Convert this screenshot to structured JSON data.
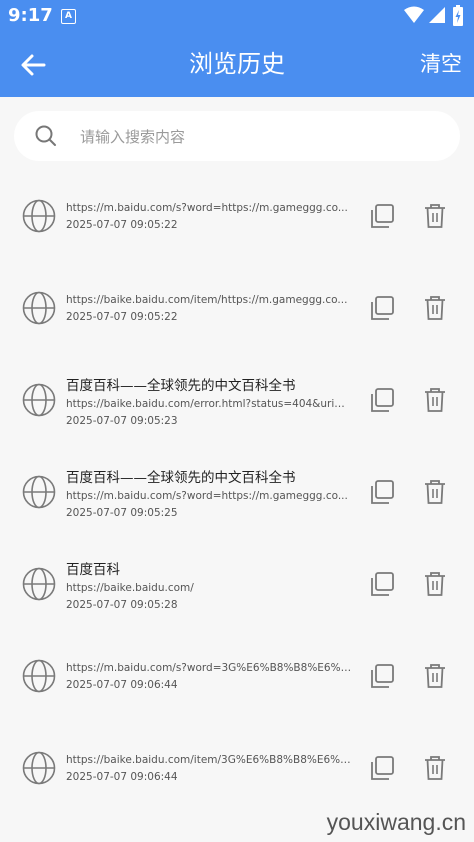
{
  "status": {
    "time": "9:17",
    "notification_badge": "A"
  },
  "appbar": {
    "title": "浏览历史",
    "clear_label": "清空"
  },
  "search": {
    "placeholder": "请输入搜索内容",
    "value": ""
  },
  "history": [
    {
      "title": "",
      "url": "https://m.baidu.com/s?word=https://m.gameggg.co...",
      "time": "2025-07-07 09:05:22"
    },
    {
      "title": "",
      "url": "https://baike.baidu.com/item/https://m.gameggg.co...",
      "time": "2025-07-07 09:05:22"
    },
    {
      "title": "百度百科——全球领先的中文百科全书",
      "url": "https://baike.baidu.com/error.html?status=404&uri=/i...",
      "time": "2025-07-07 09:05:23"
    },
    {
      "title": "百度百科——全球领先的中文百科全书",
      "url": "https://m.baidu.com/s?word=https://m.gameggg.co...",
      "time": "2025-07-07 09:05:25"
    },
    {
      "title": "百度百科",
      "url": "https://baike.baidu.com/",
      "time": "2025-07-07 09:05:28"
    },
    {
      "title": "",
      "url": "https://m.baidu.com/s?word=3G%E6%B8%B8%E6%88...",
      "time": "2025-07-07 09:06:44"
    },
    {
      "title": "",
      "url": "https://baike.baidu.com/item/3G%E6%B8%B8%E6%88...",
      "time": "2025-07-07 09:06:44"
    }
  ],
  "icons": {
    "back": "arrow-left-icon",
    "search": "search-icon",
    "entry": "globe-icon",
    "copy": "copy-icon",
    "delete": "trash-icon"
  },
  "colors": {
    "primary": "#4a8ef0",
    "background": "#f7f7f7",
    "icon": "#7a7a7a"
  },
  "watermark": "youxiwang.cn"
}
